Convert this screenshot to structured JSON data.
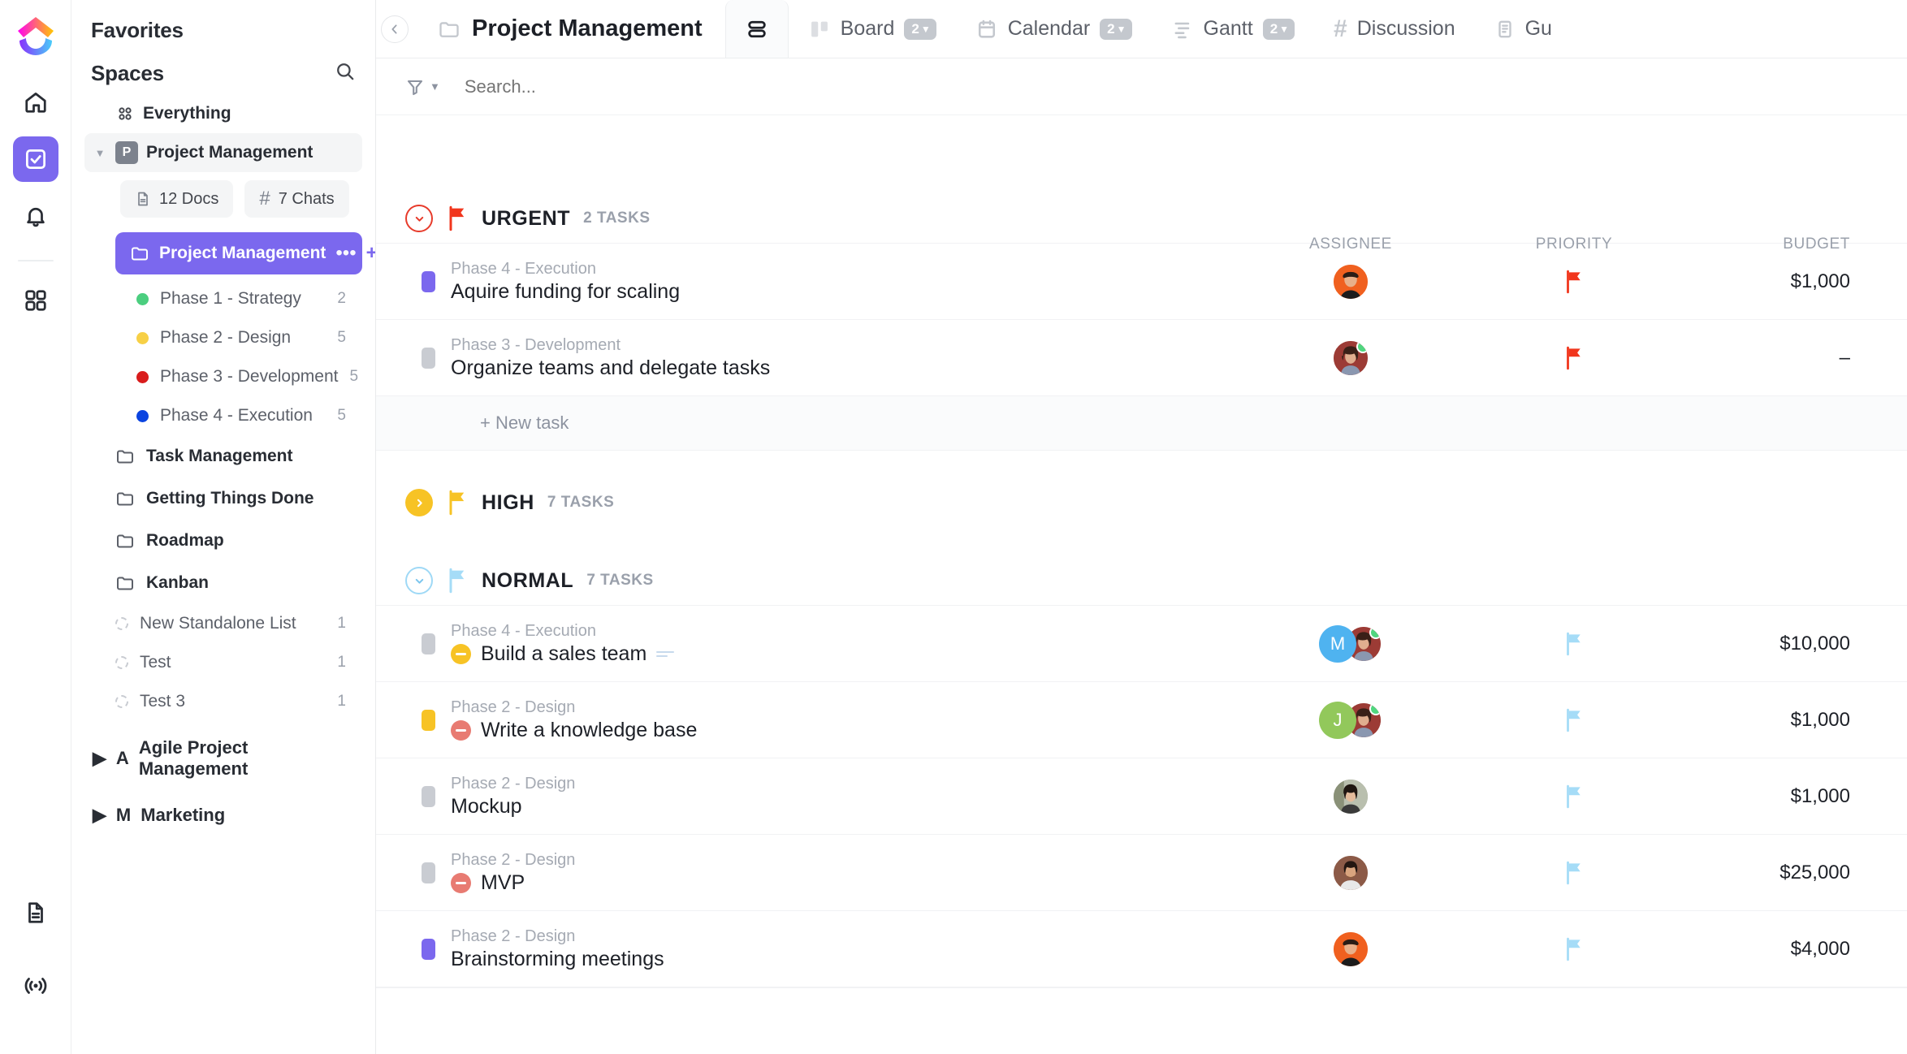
{
  "rail": {
    "logo_name": "clickup-logo",
    "items": [
      {
        "name": "home-icon",
        "label": "Home",
        "active": false
      },
      {
        "name": "tasks-icon",
        "label": "Tasks",
        "active": true
      },
      {
        "name": "notifications-bell-icon",
        "label": "Notifications",
        "active": false
      },
      {
        "name": "dashboard-grid-icon",
        "label": "Dashboards",
        "active": false
      }
    ],
    "bottom_items": [
      {
        "name": "docs-icon",
        "label": "Docs"
      },
      {
        "name": "broadcast-icon",
        "label": "Live"
      }
    ]
  },
  "sidebar": {
    "favorites_label": "Favorites",
    "spaces_label": "Spaces",
    "search_icon": "search-icon",
    "everything_label": "Everything",
    "space": {
      "avatar_letter": "P",
      "label": "Project Management",
      "expanded": true
    },
    "pills": [
      {
        "icon": "doc-icon",
        "label": "12 Docs"
      },
      {
        "icon": "hash-icon",
        "label": "7 Chats"
      }
    ],
    "active_folder": {
      "icon": "folder-icon",
      "label": "Project Management",
      "more_label": "•••",
      "add_label": "+"
    },
    "lists": [
      {
        "label": "Phase 1 - Strategy",
        "count": "2",
        "color": "#4bce7f"
      },
      {
        "label": "Phase 2 - Design",
        "count": "5",
        "color": "#f7d046"
      },
      {
        "label": "Phase 3 - Development",
        "count": "5",
        "color": "#d91c1c"
      },
      {
        "label": "Phase 4 - Execution",
        "count": "5",
        "color": "#0b44e0"
      }
    ],
    "folders": [
      {
        "icon": "folder-icon",
        "label": "Task Management"
      },
      {
        "icon": "folder-icon",
        "label": "Getting Things Done"
      },
      {
        "icon": "folder-icon",
        "label": "Roadmap"
      },
      {
        "icon": "folder-icon",
        "label": "Kanban"
      }
    ],
    "standalone_lists": [
      {
        "label": "New Standalone List",
        "count": "1"
      },
      {
        "label": "Test",
        "count": "1"
      },
      {
        "label": "Test 3",
        "count": "1"
      }
    ],
    "spaces_list": [
      {
        "avatar_letter": "A",
        "label": "Agile Project Management",
        "expanded": false
      },
      {
        "avatar_letter": "M",
        "label": "Marketing",
        "expanded": false
      }
    ]
  },
  "header": {
    "collapse_icon": "chevron-left-icon",
    "breadcrumb_icon": "folder-icon",
    "breadcrumb_title": "Project Management",
    "tabs": [
      {
        "name": "tab-list",
        "icon": "list-view-icon",
        "label": "",
        "count": "",
        "active": true
      },
      {
        "name": "tab-board",
        "icon": "board-view-icon",
        "label": "Board",
        "count": "2",
        "active": false
      },
      {
        "name": "tab-calendar",
        "icon": "calendar-view-icon",
        "label": "Calendar",
        "count": "2",
        "active": false
      },
      {
        "name": "tab-gantt",
        "icon": "gantt-view-icon",
        "label": "Gantt",
        "count": "2",
        "active": false
      },
      {
        "name": "tab-discussion",
        "icon": "hash-icon",
        "label": "Discussion",
        "count": "",
        "active": false
      },
      {
        "name": "tab-guide",
        "icon": "doc-icon",
        "label": "Gu",
        "count": "",
        "active": false
      }
    ]
  },
  "toolbar": {
    "filter_icon": "filter-funnel-icon",
    "chevron_icon": "chevron-down-icon",
    "search_placeholder": "Search..."
  },
  "table": {
    "columns": [
      "ASSIGNEE",
      "PRIORITY",
      "BUDGET"
    ],
    "new_task_label": "+ New task"
  },
  "groups": [
    {
      "name": "URGENT",
      "count": "2 TASKS",
      "color": "#e73b2b",
      "flag_color": "#f1361d",
      "expanded": true,
      "show_new_task": true,
      "tasks": [
        {
          "path": "Phase 4 - Execution",
          "title": "Aquire funding for scaling",
          "status_color": "#7b68ee",
          "badge": null,
          "assignees": [
            {
              "type": "photo",
              "bg": "#f0601f",
              "skin": "#e8b08a",
              "hair": "#2b1d16",
              "online": false
            }
          ],
          "priority_color": "#f1361d",
          "budget": "$1,000"
        },
        {
          "path": "Phase 3 - Development",
          "title": "Organize teams and delegate tasks",
          "status_color": "#c9ccd2",
          "badge": null,
          "assignees": [
            {
              "type": "photo",
              "bg": "#9c3b35",
              "skin": "#e0ae8f",
              "hair": "#3a2018",
              "online": true
            }
          ],
          "priority_color": "#f1361d",
          "budget": "–"
        }
      ]
    },
    {
      "name": "HIGH",
      "count": "7 TASKS",
      "color": "#f7c325",
      "flag_color": "#f7c325",
      "expanded": false,
      "show_new_task": false,
      "tasks": []
    },
    {
      "name": "NORMAL",
      "count": "7 TASKS",
      "color": "#9fd9f6",
      "flag_color": "#a5dcf7",
      "expanded": true,
      "show_new_task": false,
      "tasks": [
        {
          "path": "Phase 4 - Execution",
          "title": "Build a sales team",
          "status_color": "#c9ccd2",
          "badge": "#f7c325",
          "has_subtasks": true,
          "assignees": [
            {
              "type": "initial",
              "letter": "M",
              "bg": "#4fb3f0",
              "online": false
            },
            {
              "type": "photo",
              "bg": "#9c3b35",
              "skin": "#e0ae8f",
              "hair": "#3a2018",
              "online": true
            }
          ],
          "priority_color": "#a5dcf7",
          "budget": "$10,000"
        },
        {
          "path": "Phase 2 - Design",
          "title": "Write a knowledge base",
          "status_color": "#f7c325",
          "badge": "#e87b72",
          "has_subtasks": false,
          "assignees": [
            {
              "type": "initial",
              "letter": "J",
              "bg": "#92c85b",
              "online": false
            },
            {
              "type": "photo",
              "bg": "#9c3b35",
              "skin": "#e0ae8f",
              "hair": "#3a2018",
              "online": true
            }
          ],
          "priority_color": "#a5dcf7",
          "budget": "$1,000"
        },
        {
          "path": "Phase 2 - Design",
          "title": "Mockup",
          "status_color": "#c9ccd2",
          "badge": null,
          "has_subtasks": false,
          "assignees": [
            {
              "type": "photo",
              "bg": "#8a9178",
              "skin": "#e3bb9b",
              "hair": "#1f1611",
              "online": false
            }
          ],
          "priority_color": "#a5dcf7",
          "budget": "$1,000"
        },
        {
          "path": "Phase 2 - Design",
          "title": "MVP",
          "status_color": "#c9ccd2",
          "badge": "#e87b72",
          "has_subtasks": false,
          "assignees": [
            {
              "type": "photo",
              "bg": "#8c5a47",
              "skin": "#d9a47e",
              "hair": "#241611",
              "online": false
            }
          ],
          "priority_color": "#a5dcf7",
          "budget": "$25,000"
        },
        {
          "path": "Phase 2 - Design",
          "title": "Brainstorming meetings",
          "status_color": "#7b68ee",
          "badge": null,
          "has_subtasks": false,
          "assignees": [
            {
              "type": "photo",
              "bg": "#f0601f",
              "skin": "#e8b08a",
              "hair": "#2b1d16",
              "online": false
            }
          ],
          "priority_color": "#a5dcf7",
          "budget": "$4,000"
        }
      ]
    }
  ]
}
